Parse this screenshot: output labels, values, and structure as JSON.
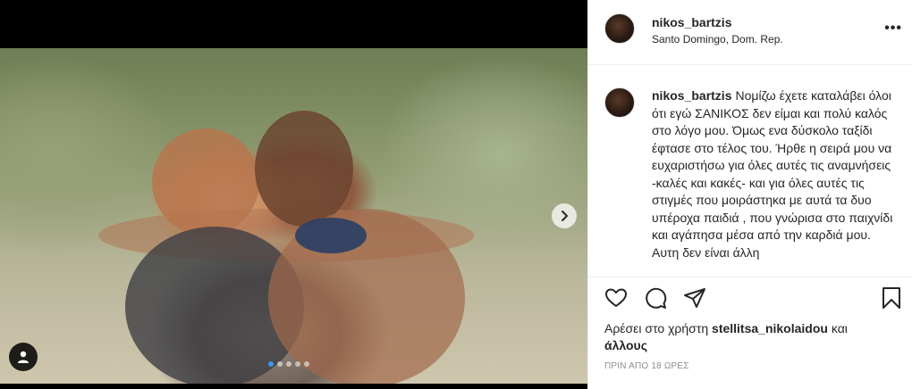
{
  "post": {
    "username": "nikos_bartzis",
    "location": "Santo Domingo, Dom. Rep.",
    "more_label": "•••",
    "caption_username": "nikos_bartzis",
    "caption_text": "Νομίζω έχετε καταλάβει όλοι ότι εγώ ΣΑΝΙΚΟΣ δεν είμαι και πολύ καλός στο λόγο μου. Όμως ενα δύσκολο ταξίδι έφτασε στο τέλος του. Ήρθε η σειρά μου να ευχαριστήσω για όλες αυτές τις αναμνήσεις -καλές και κακές- και για όλες αυτές τις στιγμές που μοιράστηκα με αυτά τα δυο υπέροχα παιδιά , που γνώρισα στο παιχνίδι και αγάπησα μέσα από την καρδιά μου. Αυτη δεν είναι άλλη",
    "likes_prefix": "Αρέσει στο χρήστη",
    "likes_user": "stellitsa_nikolaidou",
    "likes_suffix": "και",
    "likes_others": "άλλους",
    "time_ago": "ΠΡΙΝ ΑΠΟ 18 ΩΡΕΣ"
  },
  "carousel": {
    "total": 5,
    "active_index": 0
  },
  "icons": {
    "like": "heart-icon",
    "comment": "comment-icon",
    "share": "share-icon",
    "save": "bookmark-icon",
    "next": "chevron-right-icon",
    "tags": "user-tag-icon",
    "more": "more-options-icon"
  },
  "colors": {
    "text": "#262626",
    "muted": "#8e8e8e",
    "active_dot": "#3897f0",
    "divider": "#efefef"
  }
}
